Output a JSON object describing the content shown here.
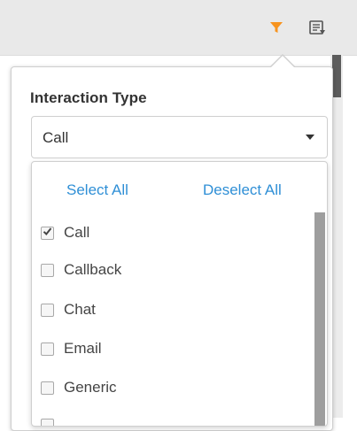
{
  "toolbar": {
    "filter_icon": "filter-icon",
    "export_icon": "export-icon",
    "accent_color": "#f7931e"
  },
  "filter_panel": {
    "field_label": "Interaction Type",
    "selected_value": "Call",
    "select_all_label": "Select All",
    "deselect_all_label": "Deselect All",
    "link_color": "#2f8fd6",
    "options": [
      {
        "label": "Call",
        "checked": true
      },
      {
        "label": "Callback",
        "checked": false
      },
      {
        "label": "Chat",
        "checked": false
      },
      {
        "label": "Email",
        "checked": false
      },
      {
        "label": "Generic",
        "checked": false
      }
    ]
  }
}
